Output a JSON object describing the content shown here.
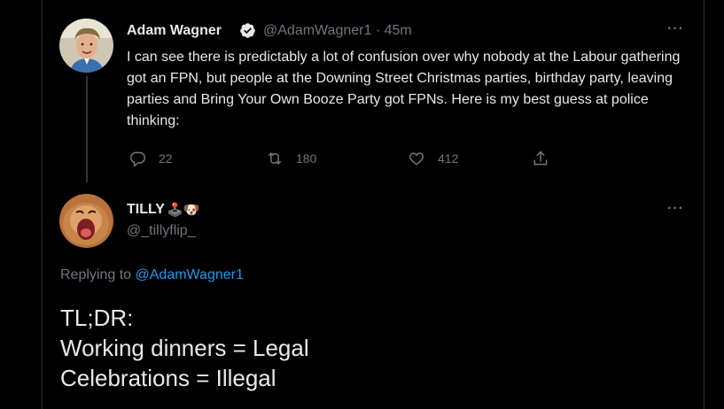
{
  "parent_tweet": {
    "author_name": "Adam Wagner",
    "author_handle_time": "@AdamWagner1 · 45m",
    "text": "I can see there is predictably a lot of confusion over why nobody at the Labour gathering got an FPN, but people at the Downing Street Christmas parties, birthday party, leaving parties and Bring Your Own Booze Party got FPNs. Here is my best guess at police thinking:",
    "more": "···",
    "actions": {
      "reply_count": "22",
      "retweet_count": "180",
      "like_count": "412"
    }
  },
  "reply_tweet": {
    "author_name": "TILLY",
    "author_emoji": "🕹️🐶",
    "author_handle": "@_tillyflip_",
    "more": "···",
    "replying_prefix": "Replying to",
    "replying_to": "@AdamWagner1",
    "lines": [
      "TL;DR:",
      "Working dinners = Legal",
      "Celebrations = Illegal"
    ]
  },
  "colors": {
    "background": "#000000",
    "text": "#e7e9ea",
    "secondary": "#71767b",
    "accent": "#1d9bf0"
  }
}
